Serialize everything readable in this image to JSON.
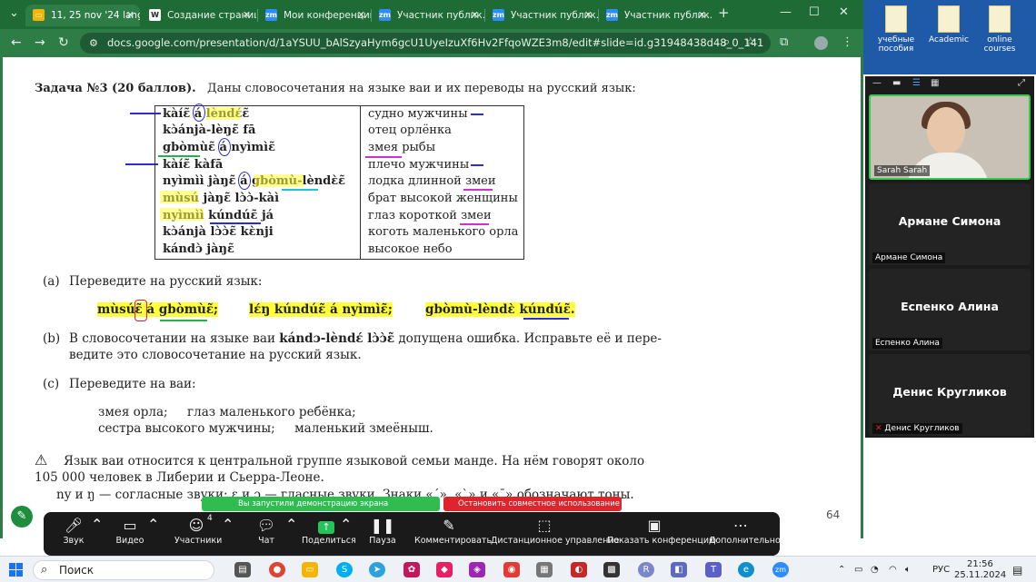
{
  "browser": {
    "tabs": [
      {
        "title": "11, 25 nov '24 lang",
        "icon": "slides-icon",
        "active": true
      },
      {
        "title": "Создание страниц",
        "icon": "wikipedia-icon"
      },
      {
        "title": "Мои конференции",
        "icon": "zoom-icon"
      },
      {
        "title": "Участник публик.",
        "icon": "zoom-icon"
      },
      {
        "title": "Участник публик.",
        "icon": "zoom-icon"
      },
      {
        "title": "Участник публик.",
        "icon": "zoom-icon"
      }
    ],
    "new_tab": "+",
    "url": "docs.google.com/presentation/d/1aYSUU_bAlSzyaHym6gcU1UyeIzuXf6Hv2FfqoWZE3m8/edit#slide=id.g31948438d48_0_141"
  },
  "slide": {
    "title_bold": "Задача №3 (20 баллов).",
    "title_rest": "Даны словосочетания на языке ваи и их переводы на русский язык:",
    "vai_phrases": [
      "kàíɛ̃ á lèndɛ́ɛ̃",
      "kɔ̀ánjà-lèŋɛ̃ fā",
      "gbòmùɛ̃ á nyìmìɛ̃",
      "kàíɛ̃ kàfā",
      "nyìmìì jàŋɛ̃ á gbòmù-lèndɛ̀ɛ̃",
      "mùsú jàŋɛ̃ lɔ̀ɔ̀-kàì",
      "nyìmìì kúndúɛ̃ já",
      "kɔ̀ánjà lɔ̀ɔ̀ɛ̃ kɛ̀nji",
      "kándɔ̀ jàŋɛ̃"
    ],
    "russian_phrases": [
      "судно мужчины",
      "отец орлёнка",
      "змея рыбы",
      "плечо мужчины",
      "лодка длинной змеи",
      "брат высокой женщины",
      "глаз короткой змеи",
      "коготь маленького орла",
      "высокое небо"
    ],
    "part_a_label": "(a)",
    "part_a_text": "Переведите на русский язык:",
    "part_a_items": [
      "mùsúɛ̃ á gbòmùɛ̃;",
      "lɛ́ŋ kúndúɛ̃ á nyìmìɛ̃;",
      "gbòmù-lèndɛ̀ kúndúɛ̃."
    ],
    "part_b_label": "(b)",
    "part_b_line1_start": "В словосочетании на языке ваи",
    "part_b_phrase": "kándɔ-lèndɛ́ lɔ̀ɔ̀ɛ̃",
    "part_b_line1_end": "допущена ошибка. Исправьте её и пере-",
    "part_b_line2": "ведите это словосочетание на русский язык.",
    "part_c_label": "(c)",
    "part_c_text": "Переведите на ваи:",
    "part_c_line1": "змея орла;     глаз маленького ребёнка;",
    "part_c_line2": "сестра высокого мужчины;     маленький змеёныш.",
    "note_icon": "⚠",
    "note_line1": "Язык ваи относится к центральной группе языковой семьи манде. На нём говорят около",
    "note_line2": "105 000 человек в Либерии и Сьерра-Леоне.",
    "note_line3": "ny и ŋ — согласные звуки; ɛ и ɔ — гласные звуки. Знаки «´», «`» и «ˉ» обозначают тоны.",
    "page_number": "64"
  },
  "share_banner": {
    "status": "Вы запустили демонстрацию экрана",
    "stop": "Остановить совместное использование"
  },
  "zoom_toolbar": {
    "items": [
      {
        "label": "Звук",
        "icon": "microphone-icon"
      },
      {
        "label": "Видео",
        "icon": "video-camera-icon"
      },
      {
        "label": "Участники",
        "icon": "participants-icon",
        "badge": "4"
      },
      {
        "label": "Чат",
        "icon": "chat-icon"
      },
      {
        "label": "Поделиться",
        "icon": "share-screen-icon"
      },
      {
        "label": "Пауза",
        "icon": "pause-icon"
      },
      {
        "label": "Комментировать",
        "icon": "annotate-pen-icon"
      },
      {
        "label": "Дистанционное управление",
        "icon": "remote-control-icon"
      },
      {
        "label": "Показать конференцию",
        "icon": "show-meeting-icon"
      },
      {
        "label": "Дополнительно",
        "icon": "more-icon"
      }
    ]
  },
  "desktop_icons": [
    "учебные пособия",
    "Academic",
    "online courses"
  ],
  "participants": [
    {
      "name": "Sarah Sarah",
      "video": true
    },
    {
      "name": "Армане Симона",
      "label": "Армане Симона"
    },
    {
      "name": "Еспенко Алина",
      "label": "Еспенко Алина"
    },
    {
      "name": "Денис Кругликов",
      "label": "Денис Кругликов",
      "muted": true
    }
  ],
  "taskbar": {
    "search_placeholder": "Поиск",
    "language": "РУС",
    "time": "21:56",
    "date": "25.11.2024"
  },
  "colors": {
    "chrome_green": "#2e7d46",
    "highlight_yellow": "#ffff3a",
    "share_green": "#2fbd52",
    "stop_red": "#e0242c"
  }
}
